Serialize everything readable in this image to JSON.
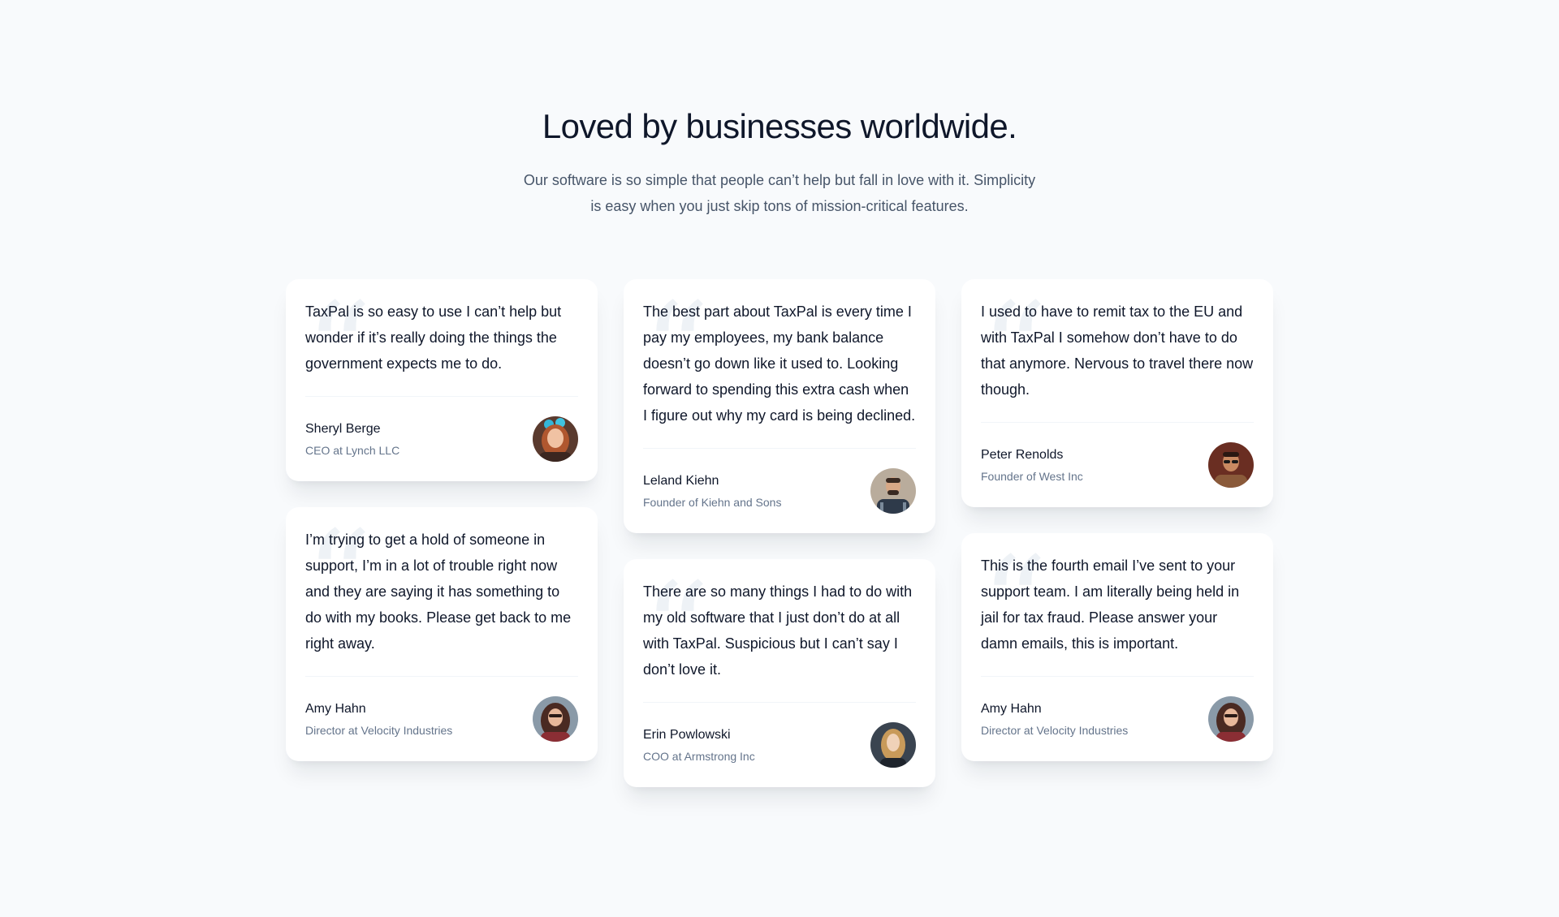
{
  "header": {
    "title": "Loved by businesses worldwide.",
    "subtitle": "Our software is so simple that people can’t help but fall in love with it. Simplicity is easy when you just skip tons of mission-critical features."
  },
  "quote_glyph": "“",
  "columns": [
    [
      {
        "quote": "TaxPal is so easy to use I can’t help but wonder if it’s really doing the things the government expects me to do.",
        "name": "Sheryl Berge",
        "role": "CEO at Lynch LLC"
      },
      {
        "quote": "I’m trying to get a hold of someone in support, I’m in a lot of trouble right now and they are saying it has something to do with my books. Please get back to me right away.",
        "name": "Amy Hahn",
        "role": "Director at Velocity Industries"
      }
    ],
    [
      {
        "quote": "The best part about TaxPal is every time I pay my employees, my bank balance doesn’t go down like it used to. Looking forward to spending this extra cash when I figure out why my card is being declined.",
        "name": "Leland Kiehn",
        "role": "Founder of Kiehn and Sons"
      },
      {
        "quote": "There are so many things I had to do with my old software that I just don’t do at all with TaxPal. Suspicious but I can’t say I don’t love it.",
        "name": "Erin Powlowski",
        "role": "COO at Armstrong Inc"
      }
    ],
    [
      {
        "quote": "I used to have to remit tax to the EU and with TaxPal I somehow don’t have to do that anymore. Nervous to travel there now though.",
        "name": "Peter Renolds",
        "role": "Founder of West Inc"
      },
      {
        "quote": "This is the fourth email I’ve sent to your support team. I am literally being held in jail for tax fraud. Please answer your damn emails, this is important.",
        "name": "Amy Hahn",
        "role": "Director at Velocity Industries"
      }
    ]
  ],
  "colors": {
    "background": "#f8fafc",
    "heading": "#0f172a",
    "body_text": "#475569",
    "muted": "#64748b"
  }
}
